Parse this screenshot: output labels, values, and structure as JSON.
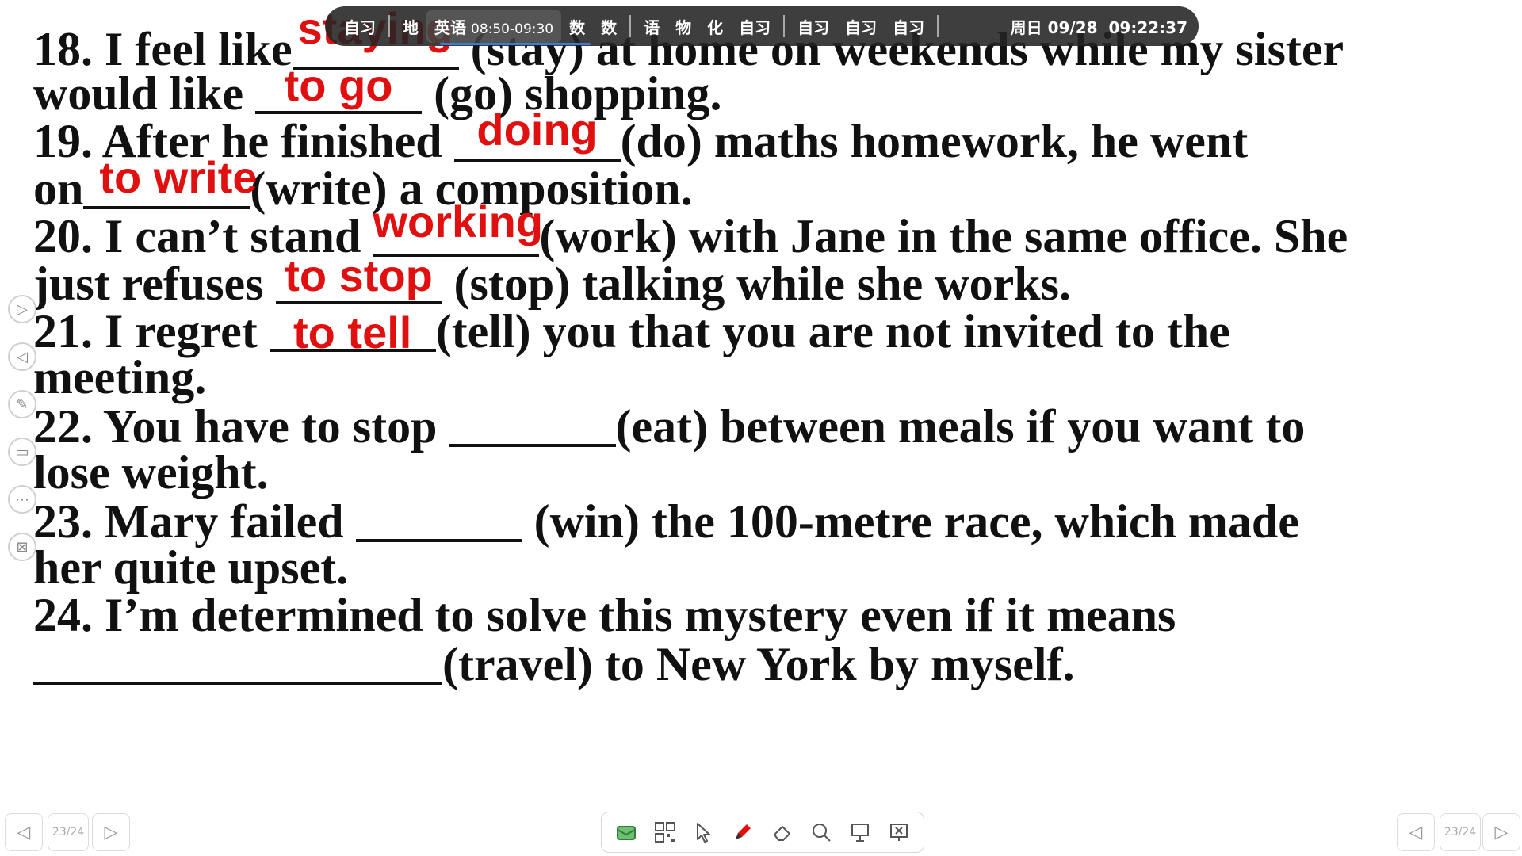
{
  "lines": {
    "l1": {
      "a": "18. I feel like",
      "b": " (stay) at home on weekends while my sister",
      "ans": "staying"
    },
    "l2": {
      "a": "would like ",
      "b": " (go) shopping.",
      "ans": "to go"
    },
    "l3": {
      "a": "19. After he finished ",
      "b": "(do) maths homework, he went",
      "ans": "doing"
    },
    "l4": {
      "a": "on",
      "b": "(write) a composition.",
      "ans": "to write"
    },
    "l5": {
      "a": "20. I can’t stand ",
      "b": "(work) with Jane in the same office. She",
      "ans": "working"
    },
    "l6": {
      "a": "just refuses ",
      "b": " (stop) talking while she works.",
      "ans": "to stop"
    },
    "l7": {
      "a": "21. I regret  ",
      "b": "(tell) you that you are not invited to the",
      "ans": "to tell"
    },
    "l8": {
      "a": "meeting."
    },
    "l9": {
      "a": "22. You have to stop ",
      "b": "(eat) between meals if you want to"
    },
    "l10": {
      "a": "lose weight."
    },
    "l11": {
      "a": "23. Mary failed ",
      "b": " (win) the 100-metre race, which made"
    },
    "l12": {
      "a": "her quite upset."
    },
    "l13": {
      "a": "24. I’m determined to solve this mystery even if it means"
    },
    "l14": {
      "b": "(travel) to New York by myself."
    }
  },
  "schedule": {
    "items": [
      "自习",
      "地",
      "英语",
      "数",
      "数",
      "语",
      "物",
      "化",
      "自习",
      "自习",
      "自习",
      "自习"
    ],
    "current_time": "08:50-09:30",
    "date": "周日 09/28",
    "clock": "09:22:37"
  },
  "nav": {
    "left_count": "23/24",
    "right_count": "23/24"
  },
  "colors": {
    "answer": "#e01010",
    "text": "#111111",
    "topbar": "#232323"
  }
}
